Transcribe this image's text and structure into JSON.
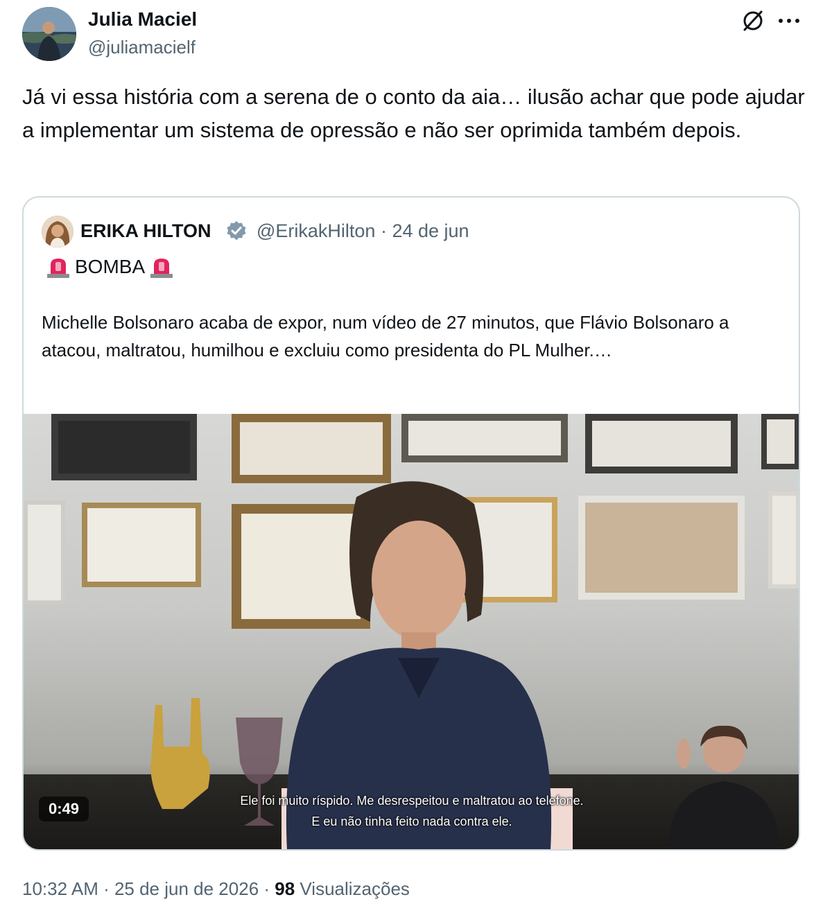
{
  "tweet": {
    "author_name": "Julia Maciel",
    "author_handle": "@juliamacielf",
    "text": "Já vi essa história com a serena de o conto da aia… ilusão achar que pode ajudar a implementar um sistema de opressão e não ser oprimida também depois.",
    "timestamp": "10:32 AM · 25 de jun de 2026",
    "separator": " · ",
    "views_count": "98",
    "views_label": "Visualizações"
  },
  "icons": {
    "grok": "grok-icon",
    "more": "more-icon",
    "verified": "verified-badge-icon",
    "siren": "police-light-icon"
  },
  "quoted": {
    "author_name": "ERIKA HILTON",
    "author_handle": "@ErikakHilton",
    "date": "24 de jun",
    "meta": "@ErikakHilton · 24 de jun",
    "headline": "BOMBA",
    "text": "Michelle Bolsonaro acaba de expor, num vídeo de 27 minutos, que Flávio Bolsonaro a atacou, maltratou, humilhou e excluiu como presidenta do PL Mulher.…",
    "video": {
      "duration": "0:49",
      "subtitle_line1": "Ele foi muito ríspido. Me desrespeitou e maltratou ao telefone.",
      "subtitle_line2": "E eu não tinha feito nada contra ele."
    }
  },
  "colors": {
    "text": "#0f1419",
    "secondary": "#536471",
    "border": "#cfd9de",
    "verified": "#829aab",
    "siren": "#e0245e"
  }
}
